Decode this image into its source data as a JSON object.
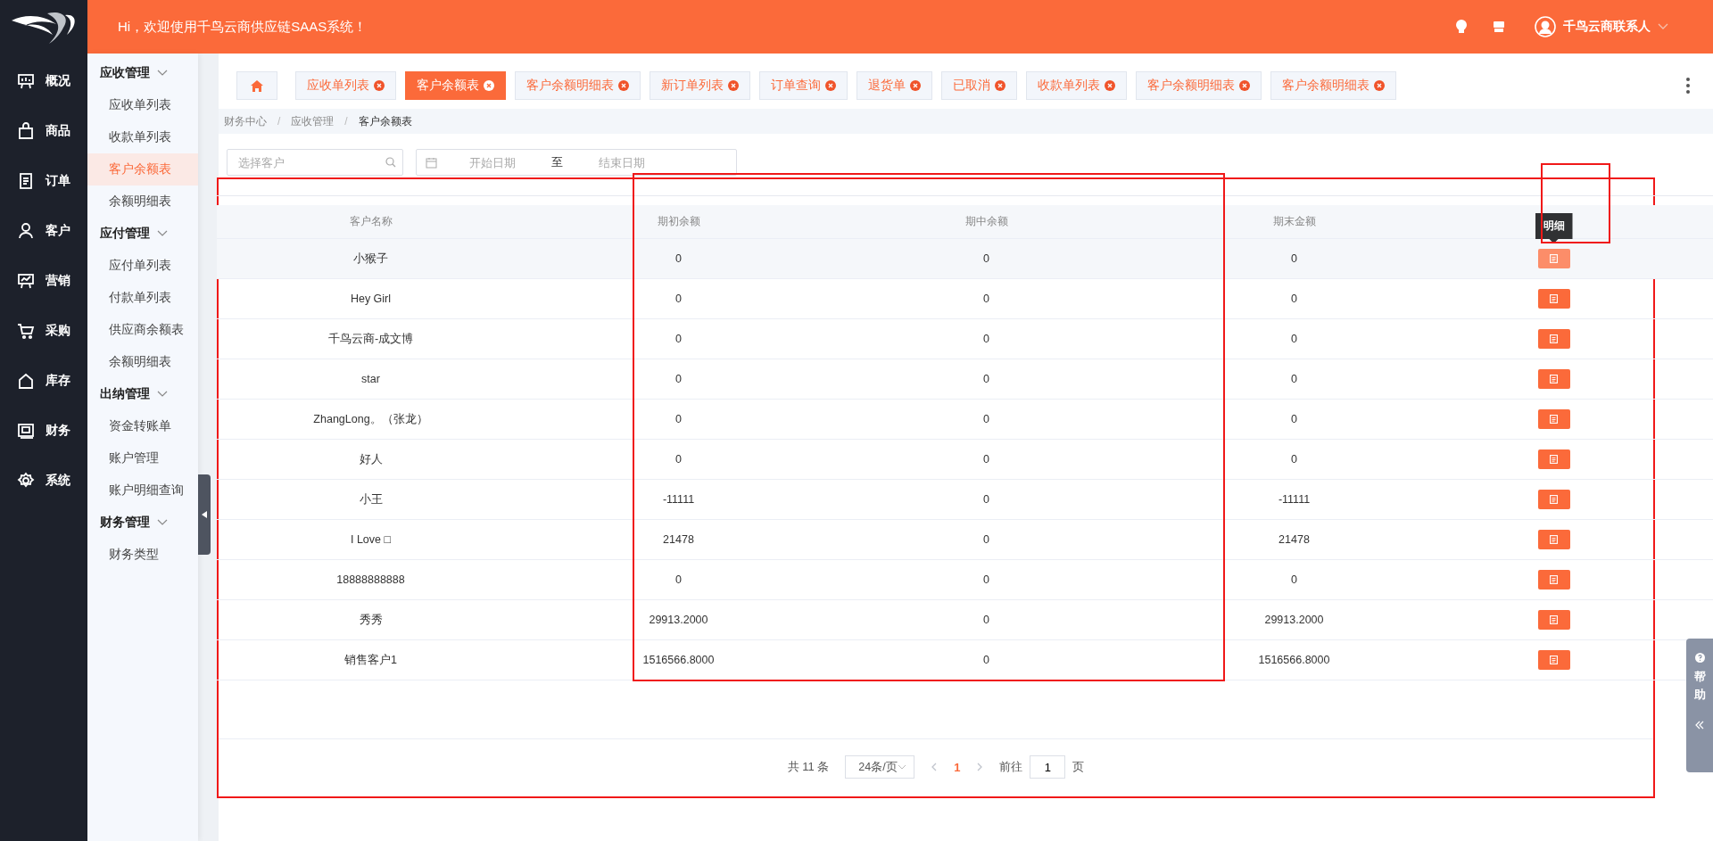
{
  "topbar": {
    "greeting": "Hi，欢迎使用千鸟云商供应链SAAS系统！",
    "user": "千鸟云商联系人"
  },
  "nav": [
    {
      "label": "概况"
    },
    {
      "label": "商品"
    },
    {
      "label": "订单"
    },
    {
      "label": "客户"
    },
    {
      "label": "营销"
    },
    {
      "label": "采购"
    },
    {
      "label": "库存"
    },
    {
      "label": "财务"
    },
    {
      "label": "系统"
    }
  ],
  "submenu": [
    {
      "title": "应收管理",
      "expanded": true,
      "items": [
        {
          "label": "应收单列表",
          "selected": false
        },
        {
          "label": "收款单列表",
          "selected": false
        },
        {
          "label": "客户余额表",
          "selected": true
        },
        {
          "label": "余额明细表",
          "selected": false
        }
      ]
    },
    {
      "title": "应付管理",
      "expanded": true,
      "items": [
        {
          "label": "应付单列表",
          "selected": false
        },
        {
          "label": "付款单列表",
          "selected": false
        },
        {
          "label": "供应商余额表",
          "selected": false
        },
        {
          "label": "余额明细表",
          "selected": false
        }
      ]
    },
    {
      "title": "出纳管理",
      "expanded": true,
      "items": [
        {
          "label": "资金转账单",
          "selected": false
        },
        {
          "label": "账户管理",
          "selected": false
        },
        {
          "label": "账户明细查询",
          "selected": false
        }
      ]
    },
    {
      "title": "财务管理",
      "expanded": true,
      "items": [
        {
          "label": "财务类型",
          "selected": false
        }
      ]
    }
  ],
  "tabs": [
    {
      "label": "应收单列表",
      "selected": false
    },
    {
      "label": "客户余额表",
      "selected": true
    },
    {
      "label": "客户余额明细表",
      "selected": false
    },
    {
      "label": "新订单列表",
      "selected": false
    },
    {
      "label": "订单查询",
      "selected": false
    },
    {
      "label": "退货单",
      "selected": false
    },
    {
      "label": "已取消",
      "selected": false
    },
    {
      "label": "收款单列表",
      "selected": false
    },
    {
      "label": "客户余额明细表",
      "selected": false
    },
    {
      "label": "客户余额明细表",
      "selected": false
    }
  ],
  "breadcrumb": {
    "items": [
      "财务中心",
      "应收管理",
      "客户余额表"
    ],
    "separator": "/"
  },
  "filters": {
    "customer_placeholder": "选择客户",
    "start_placeholder": "开始日期",
    "separator": "至",
    "end_placeholder": "结束日期"
  },
  "table": {
    "columns": [
      "客户名称",
      "期初余额",
      "期中余额",
      "期末金额"
    ],
    "rows": [
      {
        "name": "小猴子",
        "opening": "0",
        "middle": "0",
        "closing": "0",
        "hovered": true
      },
      {
        "name": "Hey Girl",
        "opening": "0",
        "middle": "0",
        "closing": "0",
        "hovered": false
      },
      {
        "name": "千鸟云商-成文博",
        "opening": "0",
        "middle": "0",
        "closing": "0",
        "hovered": false
      },
      {
        "name": "star",
        "opening": "0",
        "middle": "0",
        "closing": "0",
        "hovered": false
      },
      {
        "name": "ZhangLong。（张龙）",
        "opening": "0",
        "middle": "0",
        "closing": "0",
        "hovered": false
      },
      {
        "name": "好人",
        "opening": "0",
        "middle": "0",
        "closing": "0",
        "hovered": false
      },
      {
        "name": "小王",
        "opening": "-11111",
        "middle": "0",
        "closing": "-11111",
        "hovered": false
      },
      {
        "name": "I Love □",
        "opening": "21478",
        "middle": "0",
        "closing": "21478",
        "hovered": false
      },
      {
        "name": "18888888888",
        "opening": "0",
        "middle": "0",
        "closing": "0",
        "hovered": false
      },
      {
        "name": "秀秀",
        "opening": "29913.2000",
        "middle": "0",
        "closing": "29913.2000",
        "hovered": false
      },
      {
        "name": "销售客户1",
        "opening": "1516566.8000",
        "middle": "0",
        "closing": "1516566.8000",
        "hovered": false
      }
    ],
    "tooltip": "明细"
  },
  "pagination": {
    "total": "共 11 条",
    "page_size": "24条/页",
    "pages": [
      {
        "label": "1",
        "selected": true
      }
    ],
    "goto_label": "前往",
    "goto_value": "1",
    "page_suffix": "页"
  },
  "help": {
    "label": "帮助"
  }
}
